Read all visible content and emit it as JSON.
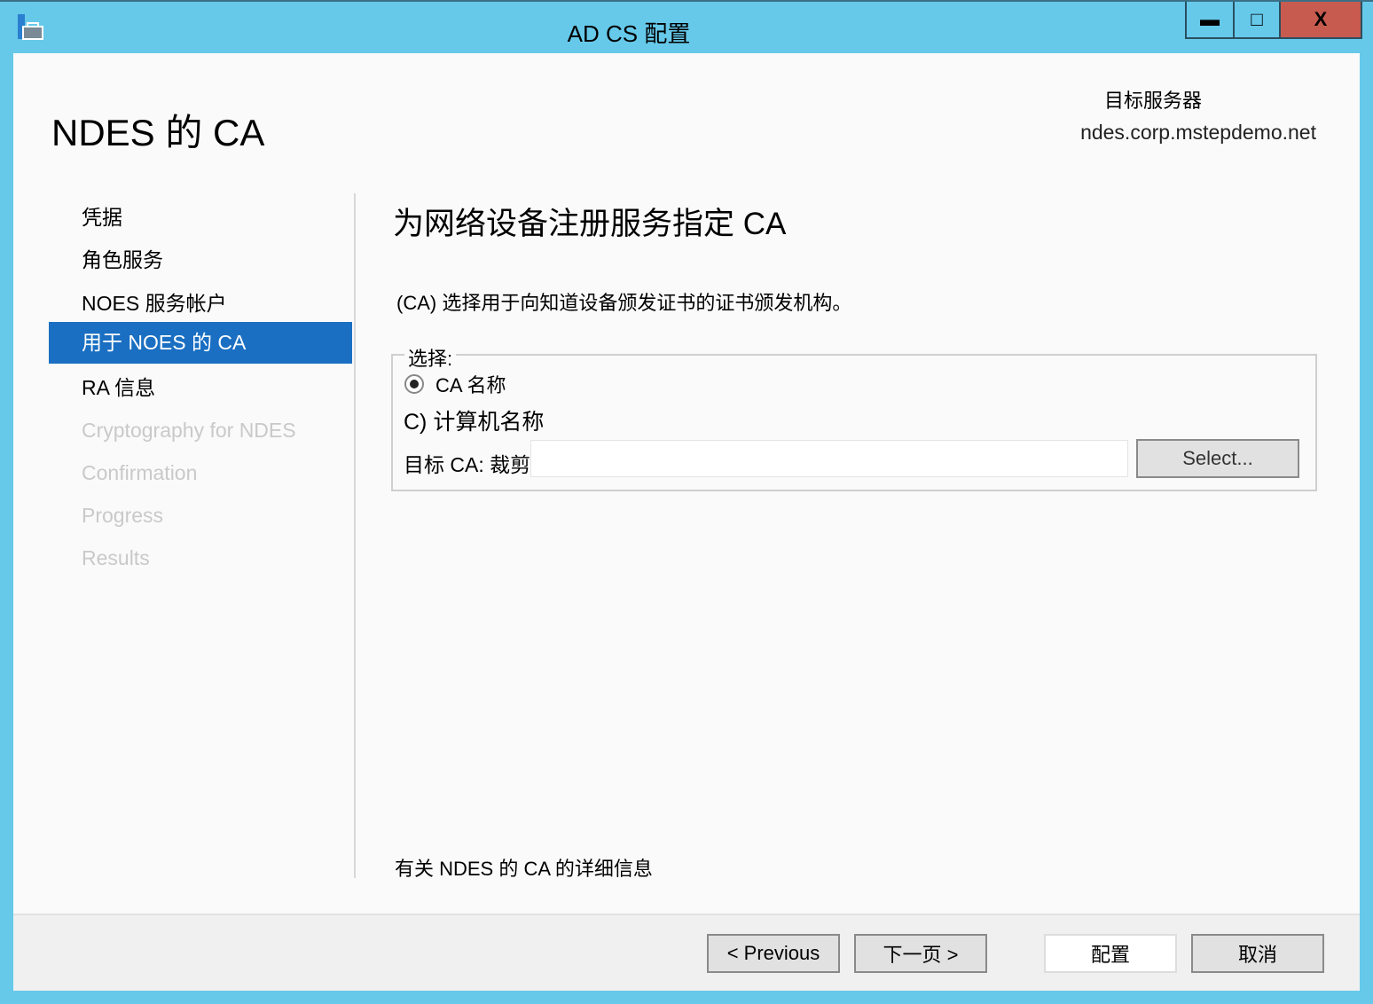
{
  "window": {
    "title": "AD CS 配置",
    "minimize": "▬",
    "maximize": "□",
    "close": "X"
  },
  "header": {
    "page_title": "NDES 的 CA",
    "target_server_label": "目标服务器",
    "target_server_value": "ndes.corp.mstepdemo.net"
  },
  "sidebar": {
    "items": [
      {
        "label": "凭据",
        "state": "normal"
      },
      {
        "label": "角色服务",
        "state": "normal"
      },
      {
        "label": "NOES 服务帐户",
        "state": "normal"
      },
      {
        "label": "用于 NOES 的 CA",
        "state": "selected"
      },
      {
        "label": "RA 信息",
        "state": "normal"
      },
      {
        "label": "Cryptography for NDES",
        "state": "disabled"
      },
      {
        "label": "Confirmation",
        "state": "disabled"
      },
      {
        "label": "Progress",
        "state": "disabled"
      },
      {
        "label": "Results",
        "state": "disabled"
      }
    ]
  },
  "main": {
    "heading": "为网络设备注册服务指定 CA",
    "description": "(CA) 选择用于向知道设备颁发证书的证书颁发机构。",
    "group_label": "选择:",
    "option_ca_name": "CA 名称",
    "option_computer_name": "C) 计算机名称",
    "target_ca_label": "目标 CA: 裁剪",
    "target_ca_value": "",
    "select_button": "Select...",
    "more_info_link": "有关 NDES 的 CA 的详细信息"
  },
  "footer": {
    "previous": "< Previous",
    "next": "下一页 >",
    "configure": "配置",
    "cancel": "取消"
  },
  "colors": {
    "titlebar": "#66c9ea",
    "selected": "#1a6fc2",
    "close": "#c75b4f"
  }
}
